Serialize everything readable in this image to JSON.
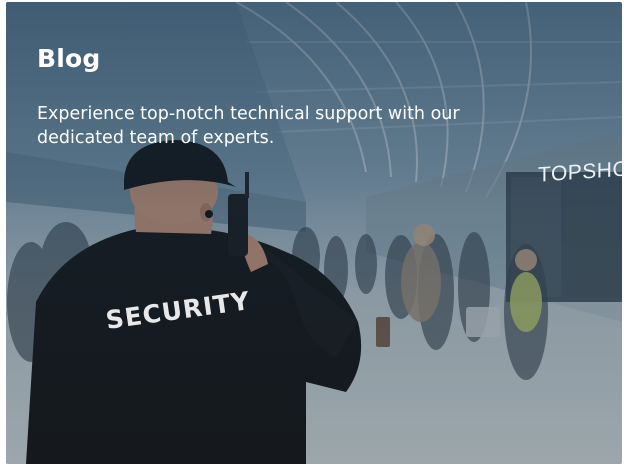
{
  "hero": {
    "title": "Blog",
    "subtitle": "Experience top-notch technical support with our dedicated team of experts."
  },
  "photo": {
    "store_sign": "TOPSHOP",
    "jacket_text": "SECURITY"
  },
  "colors": {
    "overlay": "#1f3b55",
    "text": "#ffffff",
    "jacket": "#151515"
  }
}
